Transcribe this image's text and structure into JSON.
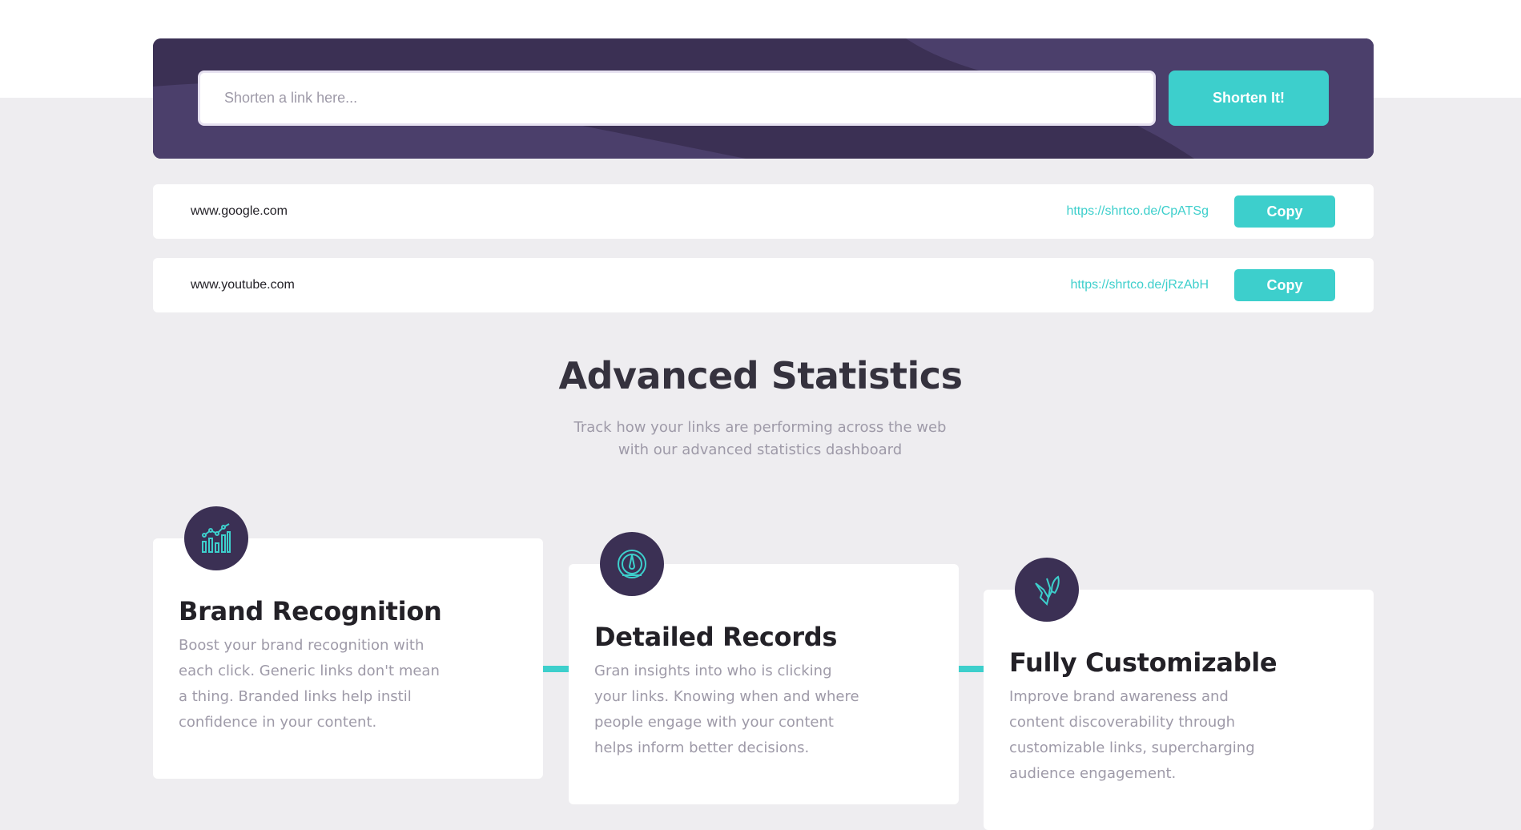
{
  "shorten": {
    "placeholder": "Shorten a link here...",
    "button_label": "Shorten It!"
  },
  "results": [
    {
      "original": "www.google.com",
      "short": "https://shrtco.de/CpATSg",
      "copy_label": "Copy"
    },
    {
      "original": "www.youtube.com",
      "short": "https://shrtco.de/jRzAbH",
      "copy_label": "Copy"
    }
  ],
  "stats": {
    "title": "Advanced Statistics",
    "subtitle": "Track how your links are performing across the web with our advanced statistics dashboard"
  },
  "features": [
    {
      "icon": "brand-recognition-icon",
      "title": "Brand Recognition",
      "text": "Boost your brand recognition with each click. Generic links don't mean a thing. Branded links help instil confidence in your content."
    },
    {
      "icon": "detailed-records-icon",
      "title": "Detailed Records",
      "text": "Gran insights into who is clicking your links. Knowing when and where people engage with your content helps inform better decisions."
    },
    {
      "icon": "fully-customizable-icon",
      "title": "Fully Customizable",
      "text": "Improve brand awareness and content discoverability through customizable links, supercharging audience engagement."
    }
  ],
  "colors": {
    "accent": "#3dcfcc",
    "dark_violet": "#3b3054",
    "page_bg": "#eeedf0"
  }
}
